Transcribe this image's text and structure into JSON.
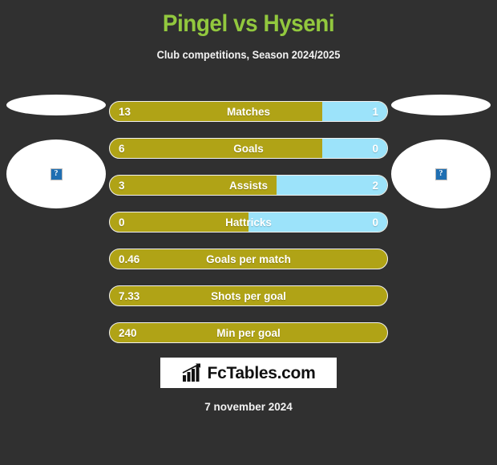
{
  "header": {
    "title": "Pingel vs Hyseni",
    "subtitle": "Club competitions, Season 2024/2025",
    "title_color": "#92c83e"
  },
  "players": {
    "home": {
      "name": "",
      "photo_icon": "broken-image-icon",
      "photo_alt": "?"
    },
    "away": {
      "name": "",
      "photo_icon": "broken-image-icon",
      "photo_alt": "?"
    }
  },
  "colors": {
    "background": "#303030",
    "home_bar": "#b0a316",
    "away_bar": "#9ce3fa",
    "text": "#ffffff"
  },
  "stats": [
    {
      "label": "Matches",
      "home": "13",
      "away": "1",
      "home_pct": 76.5,
      "has_away": true
    },
    {
      "label": "Goals",
      "home": "6",
      "away": "0",
      "home_pct": 76.5,
      "has_away": true
    },
    {
      "label": "Assists",
      "home": "3",
      "away": "2",
      "home_pct": 60,
      "has_away": true
    },
    {
      "label": "Hattricks",
      "home": "0",
      "away": "0",
      "home_pct": 50,
      "has_away": true
    },
    {
      "label": "Goals per match",
      "home": "0.46",
      "away": "",
      "home_pct": 100,
      "has_away": false
    },
    {
      "label": "Shots per goal",
      "home": "7.33",
      "away": "",
      "home_pct": 100,
      "has_away": false
    },
    {
      "label": "Min per goal",
      "home": "240",
      "away": "",
      "home_pct": 100,
      "has_away": false
    }
  ],
  "footer": {
    "brand": "FcTables.com",
    "brand_icon": "bar-chart-arrow-icon",
    "date": "7 november 2024"
  }
}
